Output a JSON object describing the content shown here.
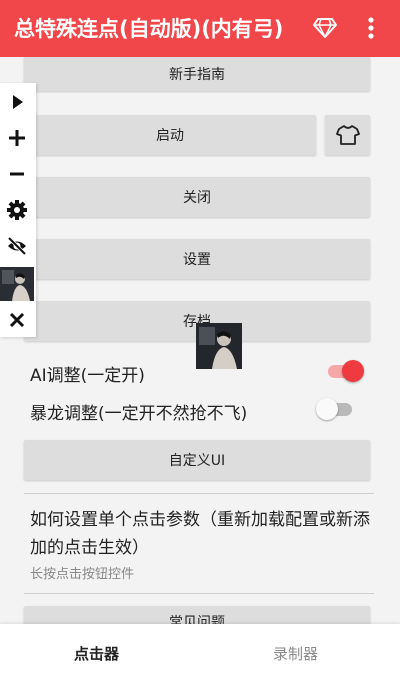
{
  "header": {
    "title": "总特殊连点(自动版)(内有弓)",
    "bg_color": "#f2474a",
    "gem_icon": "diamond-outline-icon",
    "menu_icon": "more-vert-icon"
  },
  "buttons": {
    "guide": "新手指南",
    "start": "启动",
    "skin_icon": "tshirt-icon",
    "close": "关闭",
    "settings": "设置",
    "save": "存档",
    "custom_ui": "自定义UI",
    "faq": "常见问题"
  },
  "sidebar": {
    "icons": [
      "play-icon",
      "plus-icon",
      "minus-icon",
      "gear-icon",
      "eye-off-icon",
      "avatar-thumbnail",
      "close-icon"
    ]
  },
  "toggles": {
    "ai": {
      "label": "AI调整(一定开)",
      "on": true
    },
    "dragon": {
      "label": "暴龙调整(一定开不然抢不飞)",
      "on": false
    }
  },
  "howto": {
    "title": "如何设置单个点击参数（重新加载配置或新添加的点击生效）",
    "subtitle": "长按点击按钮控件"
  },
  "bottom_nav": {
    "tabs": [
      "点击器",
      "录制器"
    ],
    "active": "点击器"
  },
  "colors": {
    "accent": "#ef3b3f",
    "button_bg": "#dddddd"
  }
}
